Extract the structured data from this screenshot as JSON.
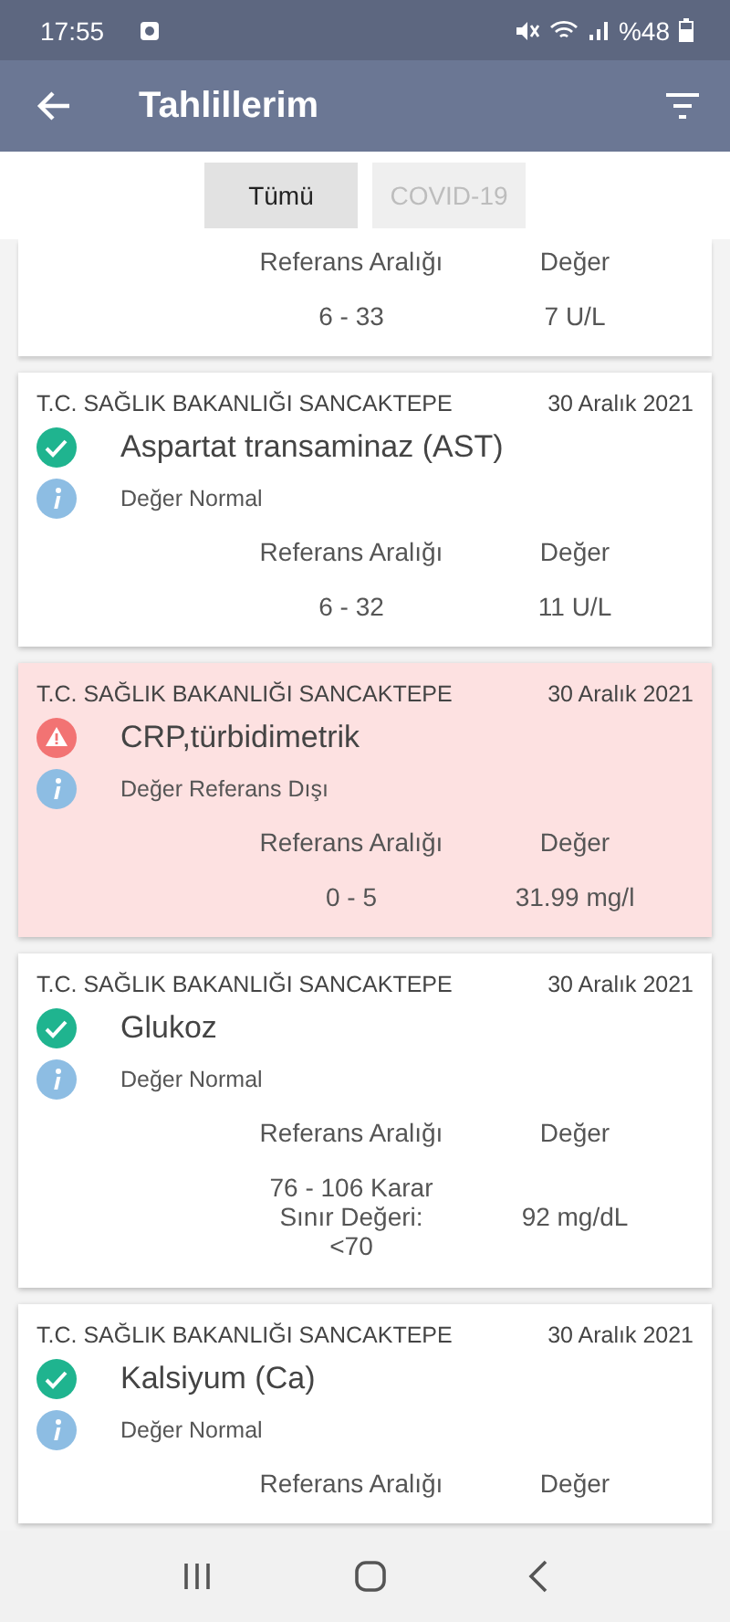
{
  "status_bar": {
    "time": "17:55",
    "battery": "%48"
  },
  "app_bar": {
    "title": "Tahlillerim"
  },
  "filters": [
    {
      "label": "Tümü",
      "selected": true
    },
    {
      "label": "COVID-19",
      "selected": false
    }
  ],
  "results": [
    {
      "range_header": "Referans Aralığı",
      "value_header": "Değer",
      "range": "6 - 33",
      "value": "7 U/L"
    },
    {
      "lab": "T.C. SAĞLIK BAKANLIĞI SANCAKTEPE",
      "date": "30 Aralık 2021",
      "kind": "normal",
      "name": "Aspartat transaminaz (AST)",
      "status": "Değer Normal",
      "range_header": "Referans Aralığı",
      "value_header": "Değer",
      "range": "6 - 32",
      "value": "11 U/L"
    },
    {
      "lab": "T.C. SAĞLIK BAKANLIĞI SANCAKTEPE",
      "date": "30 Aralık 2021",
      "kind": "out_of_range",
      "name": "CRP,türbidimetrik",
      "status": "Değer Referans Dışı",
      "range_header": "Referans Aralığı",
      "value_header": "Değer",
      "range": "0 - 5",
      "value": "31.99 mg/l"
    },
    {
      "lab": "T.C. SAĞLIK BAKANLIĞI SANCAKTEPE",
      "date": "30 Aralık 2021",
      "kind": "normal",
      "name": "Glukoz",
      "status": "Değer Normal",
      "range_header": "Referans Aralığı",
      "value_header": "Değer",
      "range": "76 - 106  Karar Sınır Değeri: <70",
      "value": "92 mg/dL"
    },
    {
      "lab": "T.C. SAĞLIK BAKANLIĞI SANCAKTEPE",
      "date": "30 Aralık 2021",
      "kind": "normal",
      "name": "Kalsiyum (Ca)",
      "status": "Değer Normal",
      "range_header": "Referans Aralığı",
      "value_header": "Değer"
    }
  ]
}
